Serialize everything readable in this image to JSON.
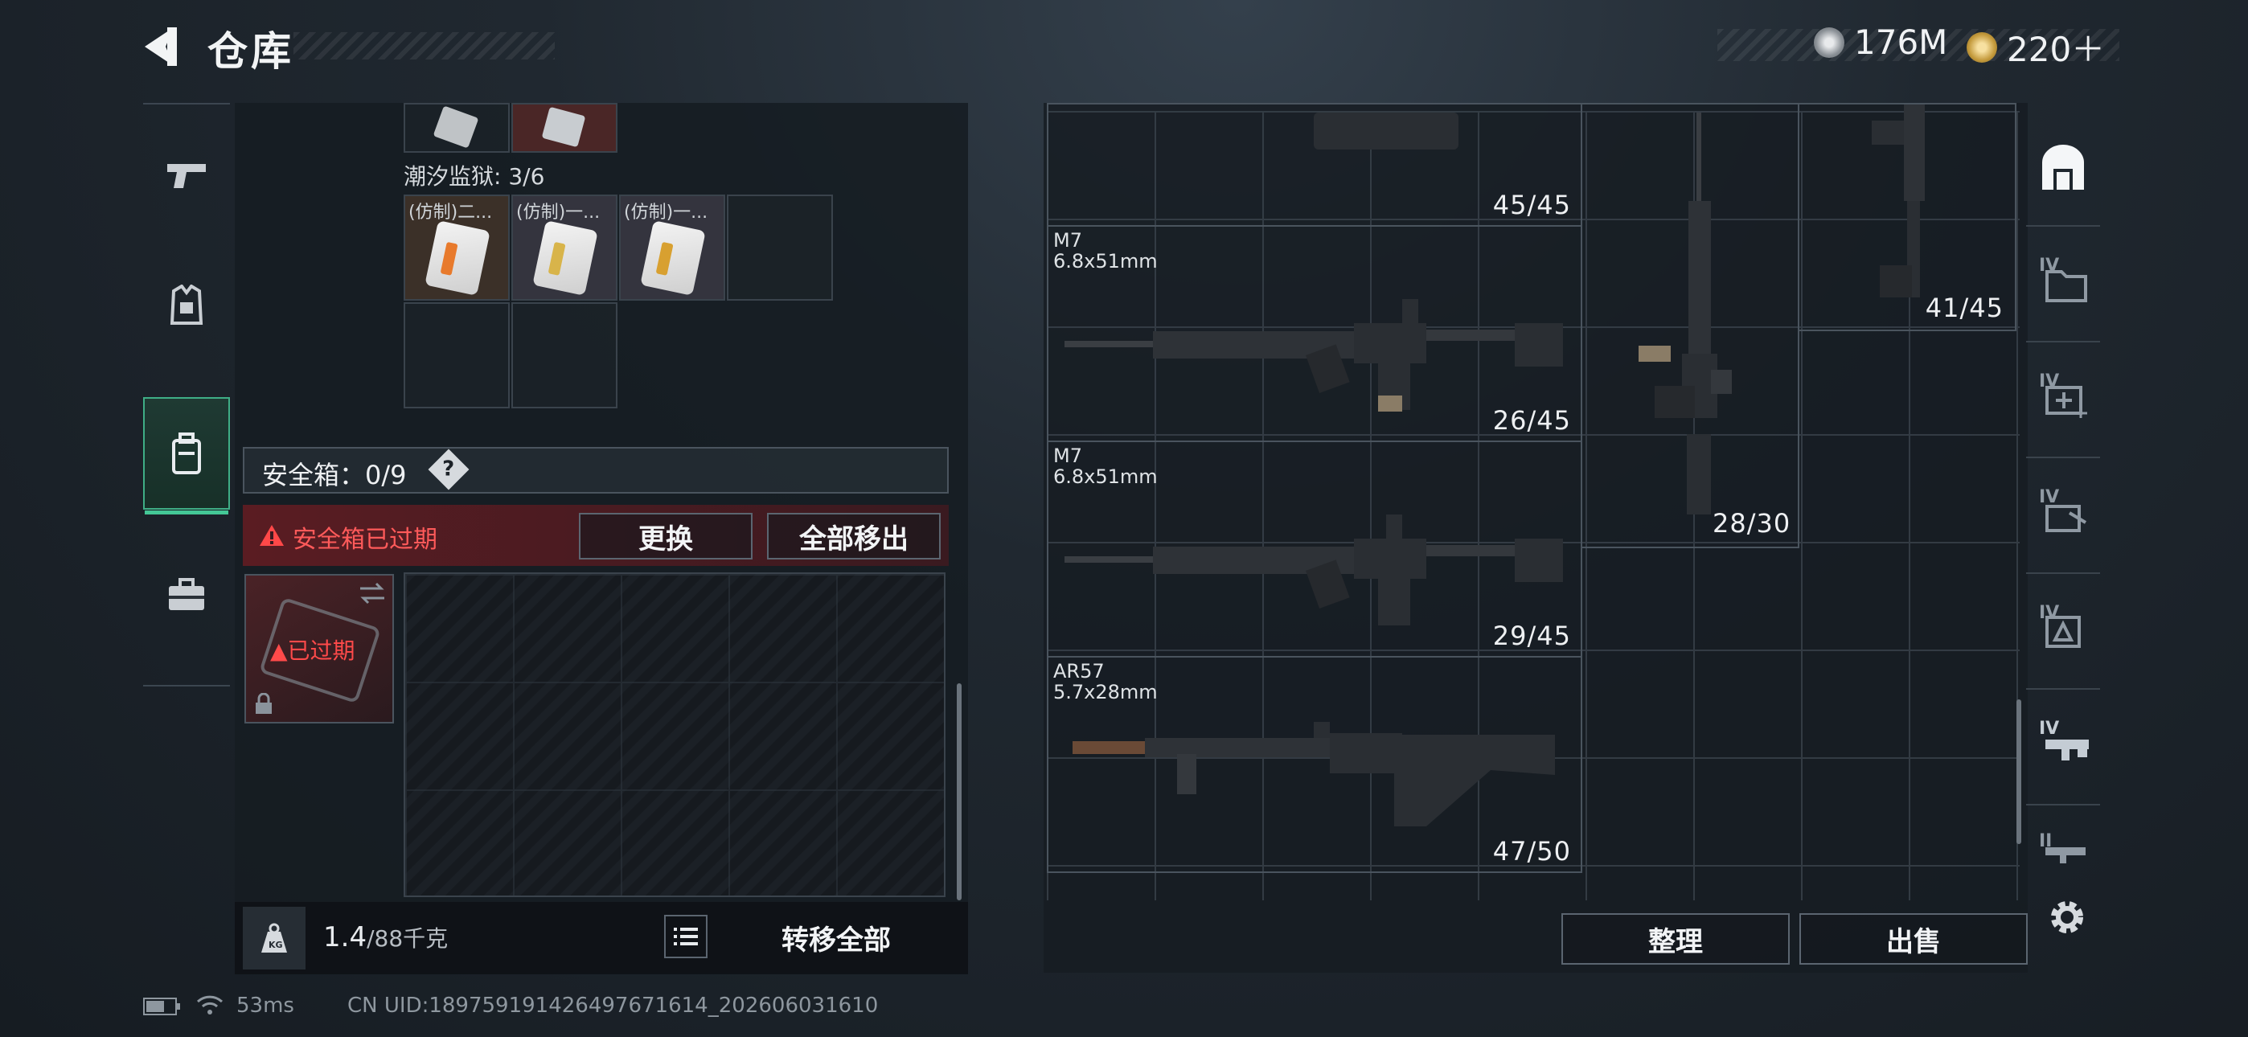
{
  "header": {
    "title": "仓库",
    "currencies": [
      {
        "icon": "silver-coin-icon",
        "value": "176M"
      },
      {
        "icon": "gold-coin-icon",
        "value": "220＋"
      }
    ]
  },
  "nav": {
    "items": [
      {
        "icon": "pistol-icon",
        "active": false
      },
      {
        "icon": "vest-icon",
        "active": false
      },
      {
        "icon": "backpack-icon",
        "active": true
      },
      {
        "icon": "toolbox-icon",
        "active": false
      }
    ]
  },
  "left": {
    "section_label": "潮汐监狱: 3/6",
    "items": [
      {
        "label": "(仿制)二..."
      },
      {
        "label": "(仿制)一..."
      },
      {
        "label": "(仿制)一..."
      }
    ],
    "safebox": {
      "label": "安全箱：0/9",
      "help": "?",
      "expired_warning": "安全箱已过期",
      "replace_button": "更换",
      "remove_all_button": "全部移出",
      "box_status": "已过期"
    },
    "footer": {
      "weight": "1.4",
      "capacity": "/88千克",
      "transfer_all": "转移全部"
    }
  },
  "right": {
    "weapons": [
      {
        "name": "",
        "ammo": "",
        "count": "45/45"
      },
      {
        "name": "M7",
        "ammo": "6.8x51mm",
        "count": "26/45"
      },
      {
        "name": "M7",
        "ammo": "6.8x51mm",
        "count": "29/45"
      },
      {
        "name": "AR57",
        "ammo": "5.7x28mm",
        "count": "47/50"
      },
      {
        "name": "",
        "ammo": "",
        "count": "28/30"
      },
      {
        "name": "",
        "ammo": "",
        "count": "41/45"
      }
    ],
    "sort_button": "整理",
    "sell_button": "出售",
    "side_tabs": [
      "IV",
      "IV",
      "IV",
      "IV",
      "IV",
      "II"
    ]
  },
  "status_bar": {
    "ping": "53ms",
    "uid": "CN UID:18975919142649767161​4_202606031610"
  }
}
